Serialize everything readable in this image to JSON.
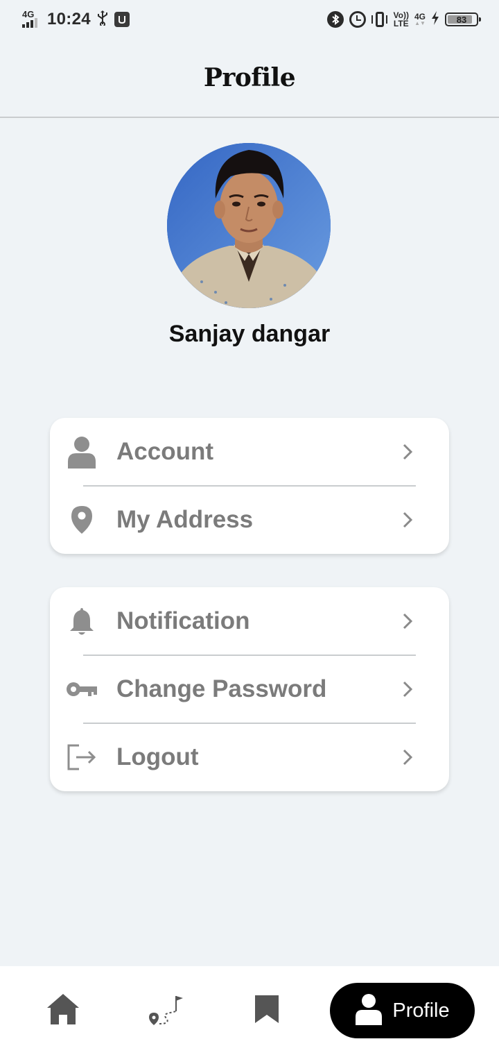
{
  "status_bar": {
    "network_type": "4G",
    "time": "10:24",
    "volte_top": "Vo))",
    "volte_bottom": "LTE",
    "data_type": "4G",
    "battery_level": "83"
  },
  "header": {
    "title": "Profile"
  },
  "user": {
    "name": "Sanjay dangar"
  },
  "menu_groups": [
    {
      "items": [
        {
          "label": "Account",
          "icon": "person-icon"
        },
        {
          "label": "My Address",
          "icon": "location-pin-icon"
        }
      ]
    },
    {
      "items": [
        {
          "label": "Notification",
          "icon": "bell-icon"
        },
        {
          "label": "Change Password",
          "icon": "key-icon"
        },
        {
          "label": "Logout",
          "icon": "logout-icon"
        }
      ]
    }
  ],
  "bottom_nav": {
    "items": [
      {
        "icon": "home-icon"
      },
      {
        "icon": "route-icon"
      },
      {
        "icon": "bookmark-icon"
      },
      {
        "icon": "person-icon",
        "label": "Profile",
        "active": true
      }
    ]
  },
  "colors": {
    "background": "#eff3f6",
    "card": "#ffffff",
    "menu_text": "#7b7b7b",
    "icon": "#8a8a8a",
    "nav_active_bg": "#000000",
    "avatar_bg": "#3f72c9"
  }
}
